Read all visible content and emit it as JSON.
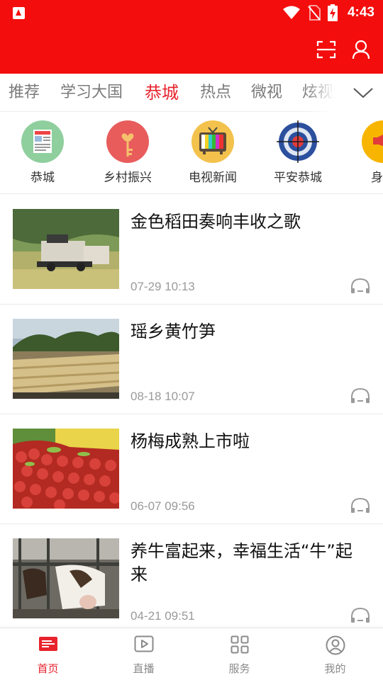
{
  "status_bar": {
    "time": "4:43"
  },
  "tabs": [
    {
      "label": "推荐",
      "active": false
    },
    {
      "label": "学习大国",
      "active": false
    },
    {
      "label": "恭城",
      "active": true
    },
    {
      "label": "热点",
      "active": false
    },
    {
      "label": "微视",
      "active": false
    },
    {
      "label": "炫视",
      "active": false
    }
  ],
  "categories": [
    {
      "label": "恭城",
      "icon": "newspaper-icon",
      "color": "#8fcf9e"
    },
    {
      "label": "乡村振兴",
      "icon": "key-icon",
      "color": "#e85c5c"
    },
    {
      "label": "电视新闻",
      "icon": "tv-icon",
      "color": "#f3c24d"
    },
    {
      "label": "平安恭城",
      "icon": "target-icon",
      "color": "#2c4f9e"
    },
    {
      "label": "身边",
      "icon": "megaphone-icon",
      "color": "#f7b500"
    }
  ],
  "news": [
    {
      "title": "金色稻田奏响丰收之歌",
      "time": "07-29 10:13"
    },
    {
      "title": "瑶乡黄竹笋",
      "time": "08-18 10:07"
    },
    {
      "title": "杨梅成熟上市啦",
      "time": "06-07 09:56"
    },
    {
      "title": "养牛富起来，幸福生活“牛”起来",
      "time": "04-21 09:51"
    }
  ],
  "bottom_nav": [
    {
      "label": "首页",
      "icon": "home-news-icon",
      "active": true
    },
    {
      "label": "直播",
      "icon": "play-icon",
      "active": false
    },
    {
      "label": "服务",
      "icon": "grid-icon",
      "active": false
    },
    {
      "label": "我的",
      "icon": "profile-icon",
      "active": false
    }
  ],
  "colors": {
    "brand_red": "#f40d0d",
    "active_text": "#e8232d",
    "muted_text": "#9a9a9a"
  }
}
